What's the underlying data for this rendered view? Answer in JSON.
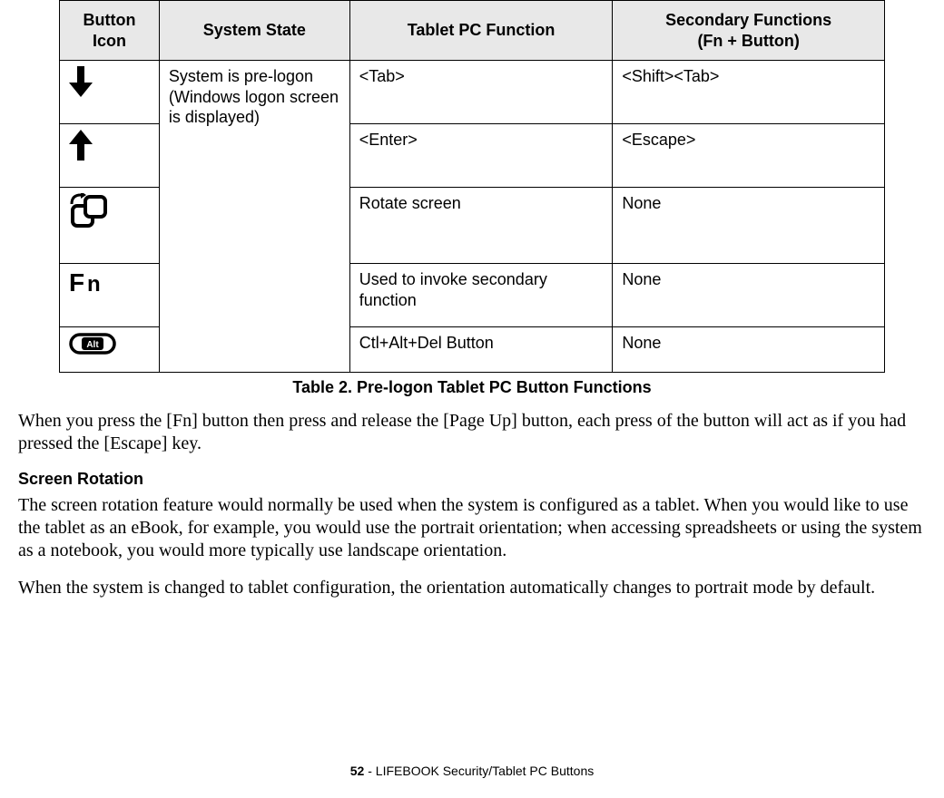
{
  "table": {
    "headers": {
      "icon": "Button Icon",
      "state": "System State",
      "func": "Tablet PC Function",
      "secondary_l1": "Secondary Functions",
      "secondary_l2": "(Fn + Button)"
    },
    "state_text": "System is pre-logon (Windows logon screen is displayed)",
    "rows": [
      {
        "icon": "arrow-down-icon",
        "func": "<Tab>",
        "secondary": "<Shift><Tab>"
      },
      {
        "icon": "arrow-up-icon",
        "func": "<Enter>",
        "secondary": "<Escape>"
      },
      {
        "icon": "rotate-icon",
        "func": "Rotate screen",
        "secondary": "None"
      },
      {
        "icon": "fn-icon",
        "func": "Used to invoke secondary function",
        "secondary": "None"
      },
      {
        "icon": "alt-icon",
        "func": "Ctl+Alt+Del Button",
        "secondary": "None"
      }
    ],
    "caption": "Table 2.  Pre-logon Tablet PC Button Functions"
  },
  "paragraphs": {
    "p1": "When you press the [Fn] button then press and release the [Page Up] button, each press of the button will act as if you had pressed the [Escape] key.",
    "h1": "Screen Rotation",
    "p2": "The screen rotation feature would normally be used when the system is configured as a tablet. When you would like to use the tablet as an eBook, for example, you would use the portrait orientation; when accessing spreadsheets or using the system as a notebook, you would more typically use landscape orientation.",
    "p3": "When the system is changed to tablet configuration, the orientation automatically changes to portrait mode by default."
  },
  "footer": {
    "page_number": "52",
    "sep": " - ",
    "title": "LIFEBOOK Security/Tablet PC Buttons"
  }
}
